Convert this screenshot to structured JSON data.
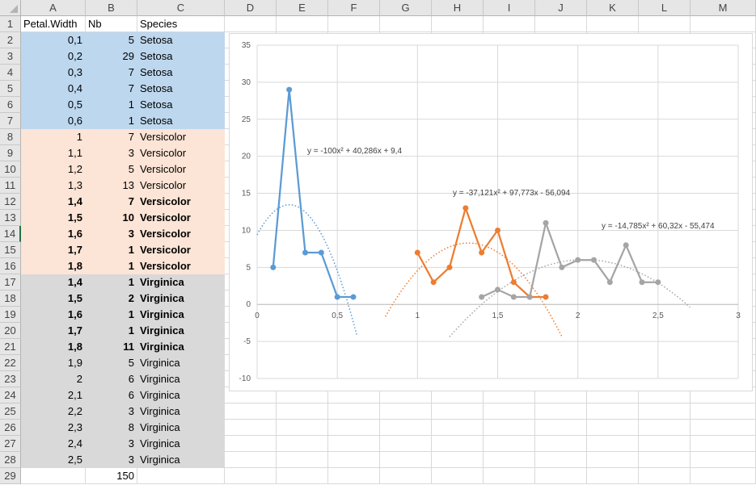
{
  "columns": [
    "A",
    "B",
    "C",
    "D",
    "E",
    "F",
    "G",
    "H",
    "I",
    "J",
    "K",
    "L",
    "M"
  ],
  "header_row": {
    "a": "Petal.Width",
    "b": "Nb",
    "c": "Species"
  },
  "rows": [
    {
      "a": "0,1",
      "b": "5",
      "c": "Setosa",
      "group": "set",
      "bold": false
    },
    {
      "a": "0,2",
      "b": "29",
      "c": "Setosa",
      "group": "set",
      "bold": false
    },
    {
      "a": "0,3",
      "b": "7",
      "c": "Setosa",
      "group": "set",
      "bold": false
    },
    {
      "a": "0,4",
      "b": "7",
      "c": "Setosa",
      "group": "set",
      "bold": false
    },
    {
      "a": "0,5",
      "b": "1",
      "c": "Setosa",
      "group": "set",
      "bold": false
    },
    {
      "a": "0,6",
      "b": "1",
      "c": "Setosa",
      "group": "set",
      "bold": false
    },
    {
      "a": "1",
      "b": "7",
      "c": "Versicolor",
      "group": "ver",
      "bold": false
    },
    {
      "a": "1,1",
      "b": "3",
      "c": "Versicolor",
      "group": "ver",
      "bold": false
    },
    {
      "a": "1,2",
      "b": "5",
      "c": "Versicolor",
      "group": "ver",
      "bold": false
    },
    {
      "a": "1,3",
      "b": "13",
      "c": "Versicolor",
      "group": "ver",
      "bold": false
    },
    {
      "a": "1,4",
      "b": "7",
      "c": "Versicolor",
      "group": "ver",
      "bold": true
    },
    {
      "a": "1,5",
      "b": "10",
      "c": "Versicolor",
      "group": "ver",
      "bold": true
    },
    {
      "a": "1,6",
      "b": "3",
      "c": "Versicolor",
      "group": "ver",
      "bold": true
    },
    {
      "a": "1,7",
      "b": "1",
      "c": "Versicolor",
      "group": "ver",
      "bold": true
    },
    {
      "a": "1,8",
      "b": "1",
      "c": "Versicolor",
      "group": "ver",
      "bold": true
    },
    {
      "a": "1,4",
      "b": "1",
      "c": "Virginica",
      "group": "vir",
      "bold": true
    },
    {
      "a": "1,5",
      "b": "2",
      "c": "Virginica",
      "group": "vir",
      "bold": true
    },
    {
      "a": "1,6",
      "b": "1",
      "c": "Virginica",
      "group": "vir",
      "bold": true
    },
    {
      "a": "1,7",
      "b": "1",
      "c": "Virginica",
      "group": "vir",
      "bold": true
    },
    {
      "a": "1,8",
      "b": "11",
      "c": "Virginica",
      "group": "vir",
      "bold": true
    },
    {
      "a": "1,9",
      "b": "5",
      "c": "Virginica",
      "group": "vir",
      "bold": false
    },
    {
      "a": "2",
      "b": "6",
      "c": "Virginica",
      "group": "vir",
      "bold": false
    },
    {
      "a": "2,1",
      "b": "6",
      "c": "Virginica",
      "group": "vir",
      "bold": false
    },
    {
      "a": "2,2",
      "b": "3",
      "c": "Virginica",
      "group": "vir",
      "bold": false
    },
    {
      "a": "2,3",
      "b": "8",
      "c": "Virginica",
      "group": "vir",
      "bold": false
    },
    {
      "a": "2,4",
      "b": "3",
      "c": "Virginica",
      "group": "vir",
      "bold": false
    },
    {
      "a": "2,5",
      "b": "3",
      "c": "Virginica",
      "group": "vir",
      "bold": false
    }
  ],
  "total_row": {
    "b": "150"
  },
  "selected_row": 14,
  "colors": {
    "set": "#bdd7ee",
    "ver": "#fce4d6",
    "vir": "#d9d9d9"
  },
  "chart_data": {
    "type": "scatter",
    "xlim": [
      0,
      3
    ],
    "ylim": [
      -10,
      35
    ],
    "x_ticks": [
      "0",
      "0,5",
      "1",
      "1,5",
      "2",
      "2,5",
      "3"
    ],
    "y_ticks": [
      "-10",
      "-5",
      "0",
      "5",
      "10",
      "15",
      "20",
      "25",
      "30",
      "35"
    ],
    "grid": true,
    "series": [
      {
        "color": "#5b9bd5",
        "x": [
          0.1,
          0.2,
          0.3,
          0.4,
          0.5,
          0.6
        ],
        "y": [
          5,
          29,
          7,
          7,
          1,
          1
        ],
        "trend": {
          "a": -100,
          "b": 40.286,
          "c": 9.4,
          "from": 0,
          "to": 0.62
        },
        "equation": "y = -100x² + 40,286x + 9,4"
      },
      {
        "color": "#ed7d31",
        "x": [
          1,
          1.1,
          1.2,
          1.3,
          1.4,
          1.5,
          1.6,
          1.7,
          1.8
        ],
        "y": [
          7,
          3,
          5,
          13,
          7,
          10,
          3,
          1,
          1
        ],
        "trend": {
          "a": -37.121,
          "b": 97.773,
          "c": -56.094,
          "from": 0.8,
          "to": 1.9
        },
        "equation": "y = -37,121x² + 97,773x - 56,094"
      },
      {
        "color": "#a5a5a5",
        "x": [
          1.4,
          1.5,
          1.6,
          1.7,
          1.8,
          1.9,
          2,
          2.1,
          2.2,
          2.3,
          2.4,
          2.5
        ],
        "y": [
          1,
          2,
          1,
          1,
          11,
          5,
          6,
          6,
          3,
          8,
          3,
          3
        ],
        "trend": {
          "a": -14.785,
          "b": 60.32,
          "c": -55.474,
          "from": 1.2,
          "to": 2.7
        },
        "equation": "y = -14,785x² + 60,32x - 55,474"
      }
    ]
  }
}
